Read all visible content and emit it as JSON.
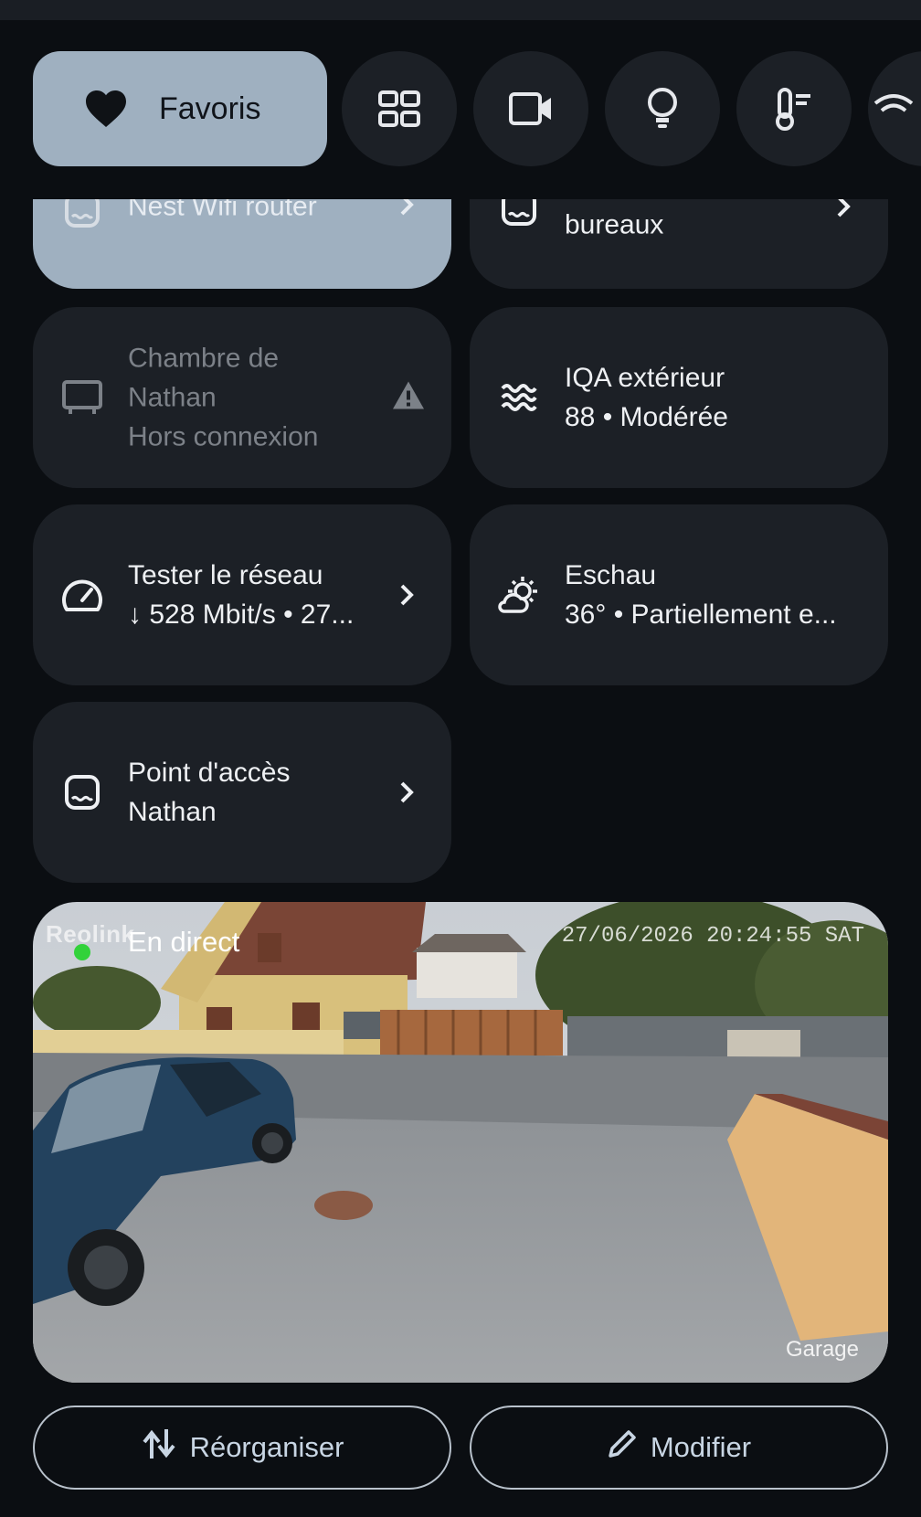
{
  "chips": {
    "favorites_label": "Favoris",
    "items": [
      "heart-icon",
      "grid-icon",
      "camera-icon",
      "lightbulb-icon",
      "thermometer-icon",
      "wifi-icon"
    ]
  },
  "tiles": {
    "router": {
      "label": "Nest Wifi router",
      "icon": "router-icon"
    },
    "offices": {
      "label": "bureaux",
      "icon": "router-icon"
    },
    "nathan_room": {
      "line1": "Chambre de",
      "line2": "Nathan",
      "line3": "Hors connexion",
      "icon": "display-icon"
    },
    "aqi": {
      "line1": "IQA extérieur",
      "line2": "88 • Modérée",
      "icon": "air-quality-icon"
    },
    "network_test": {
      "line1": "Tester le réseau",
      "line2": "↓ 528 Mbit/s • 27...",
      "icon": "speedometer-icon"
    },
    "weather": {
      "line1": "Eschau",
      "line2": "36° • Partiellement e...",
      "icon": "partly-cloudy-icon"
    },
    "access_point": {
      "line1": "Point d'accès",
      "line2": "Nathan",
      "icon": "router-icon"
    }
  },
  "camera": {
    "brand": "Reolink",
    "status": "En direct",
    "timestamp": "27/06/2026 20:24:55 SAT",
    "name": "Garage"
  },
  "actions": {
    "reorganize_label": "Réorganiser",
    "edit_label": "Modifier"
  },
  "colors": {
    "background": "#0b0e12",
    "tile": "#1c2026",
    "accent": "#9fb0c0",
    "live_dot": "#32d23a"
  }
}
